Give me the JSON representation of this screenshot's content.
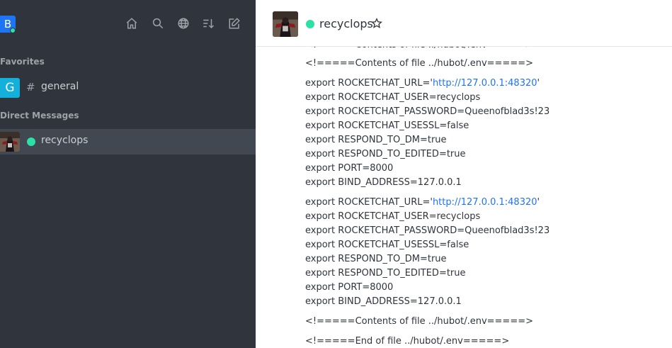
{
  "sidebar": {
    "user_avatar_letter": "B",
    "header_icons": [
      "home-icon",
      "search-icon",
      "globe-icon",
      "sort-icon",
      "edit-icon"
    ],
    "favorites_label": "Favorites",
    "direct_messages_label": "Direct Messages",
    "favorites": [
      {
        "avatar_letter": "G",
        "name": "general"
      }
    ],
    "direct_messages": [
      {
        "name": "recyclops",
        "status": "online"
      }
    ]
  },
  "room_header": {
    "name": "recyclops",
    "status": "online"
  },
  "messages": {
    "partial_top": "<!=====Contents of file ../hubot/.env=====>",
    "block1_header": "<!=====Contents of file ../hubot/.env=====>",
    "env_block_1": {
      "url_prefix": "export ROCKETCHAT_URL='",
      "url": "http://127.0.0.1:48320",
      "url_suffix": "'",
      "lines": [
        "export ROCKETCHAT_USER=recyclops",
        "export ROCKETCHAT_PASSWORD=Queenofblad3s!23",
        "export ROCKETCHAT_USESSL=false",
        "export RESPOND_TO_DM=true",
        "export RESPOND_TO_EDITED=true",
        "export PORT=8000",
        "export BIND_ADDRESS=127.0.0.1"
      ]
    },
    "env_block_2": {
      "url_prefix": "export ROCKETCHAT_URL='",
      "url": "http://127.0.0.1:48320",
      "url_suffix": "'",
      "lines": [
        "export ROCKETCHAT_USER=recyclops",
        "export ROCKETCHAT_PASSWORD=Queenofblad3s!23",
        "export ROCKETCHAT_USESSL=false",
        "export RESPOND_TO_DM=true",
        "export RESPOND_TO_EDITED=true",
        "export PORT=8000",
        "export BIND_ADDRESS=127.0.0.1"
      ]
    },
    "footer_contents": "<!=====Contents of file ../hubot/.env=====>",
    "footer_end": "<!=====End of file ../hubot/.env=====>"
  },
  "colors": {
    "sidebar_bg": "#2f343d",
    "active_room_bg": "#414852",
    "online": "#2de0a5",
    "link": "#1d74f5",
    "brand": "#1d74f5",
    "general_avatar": "#12b0da"
  }
}
